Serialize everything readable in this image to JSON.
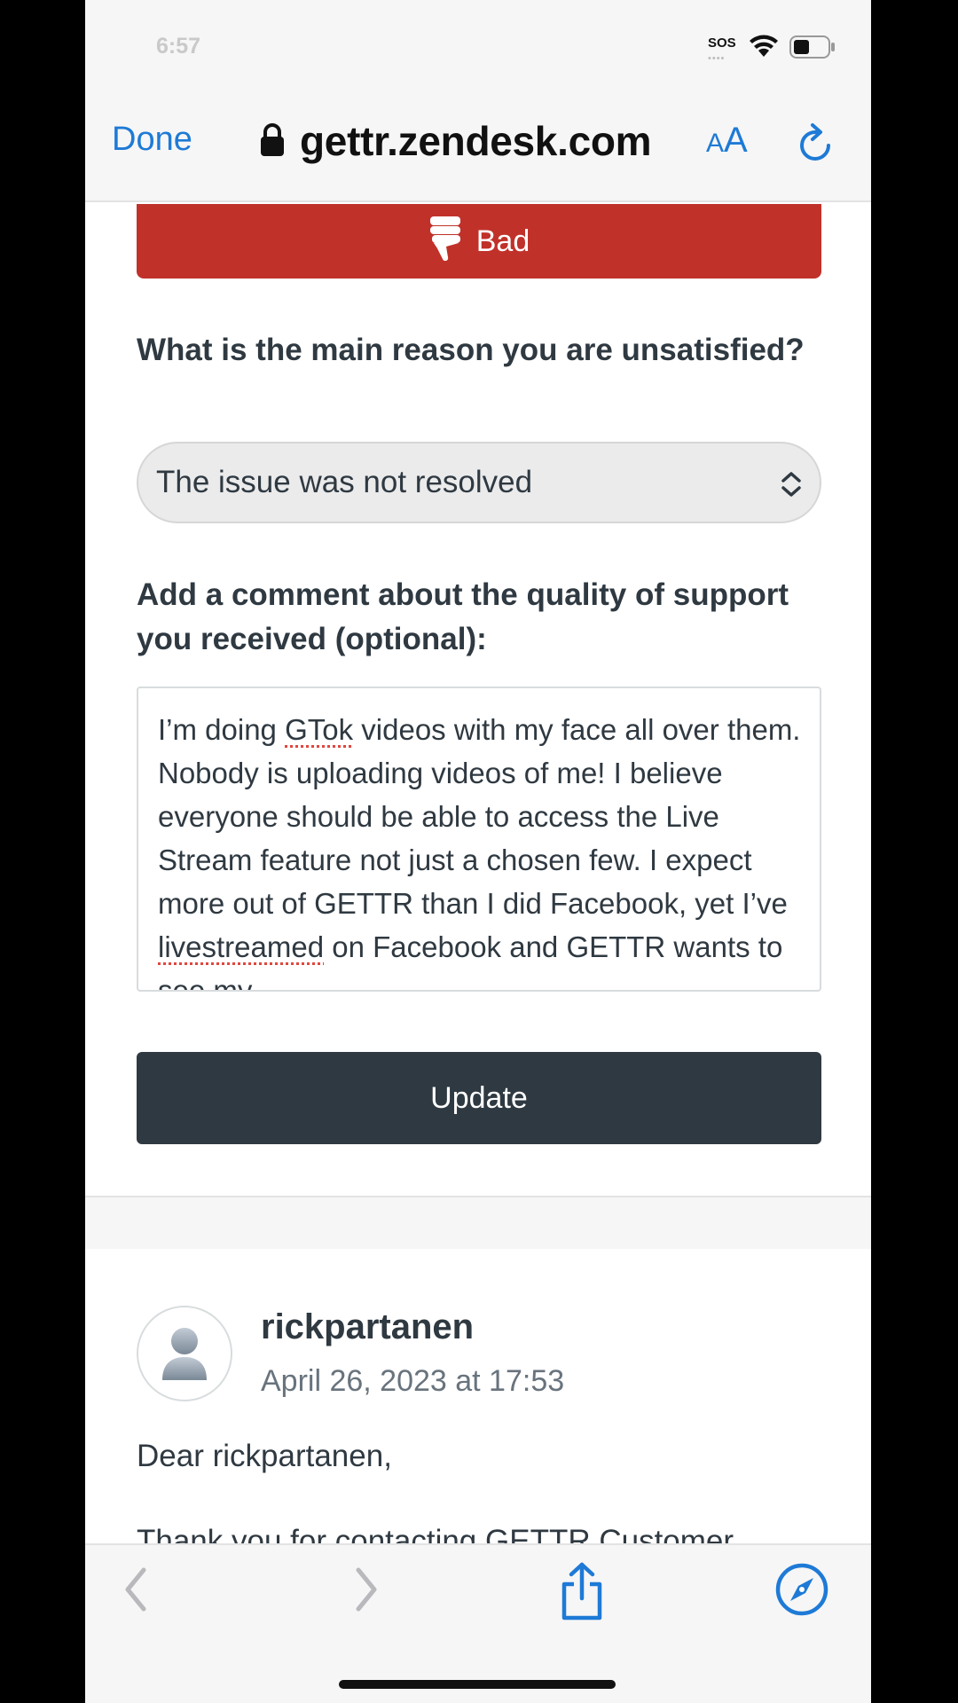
{
  "status_bar": {
    "time": "6:57",
    "sos": "SOS"
  },
  "browser": {
    "done_label": "Done",
    "url": "gettr.zendesk.com",
    "text_size_small": "A",
    "text_size_big": "A",
    "accent_color": "#1e7ad6"
  },
  "survey": {
    "rating_label": "Bad",
    "rating_color": "#c0312a",
    "reason_question": "What is the main reason you are unsatisfied?",
    "reason_selected": "The issue was not resolved",
    "comment_question": "Add a comment about the quality of support you received (optional):",
    "comment_text_parts": {
      "a": "I’m doing ",
      "b": "GTok",
      "c": " videos with my face all over them. Nobody is uploading videos of me! I believe everyone should be able to access the Live Stream feature not just a chosen few. I expect more out of GETTR than I did Facebook, yet I’ve ",
      "d": "livestreamed",
      "e": " on Facebook and GETTR wants to see my"
    },
    "update_label": "Update"
  },
  "message": {
    "author": "rickpartanen",
    "date": "April 26, 2023 at 17:53",
    "greeting": "Dear rickpartanen,",
    "body_first_line": "Thank you for contacting GETTR Customer"
  },
  "toolbar": {
    "icons": [
      "back-icon",
      "forward-icon",
      "share-icon",
      "compass-icon"
    ]
  }
}
